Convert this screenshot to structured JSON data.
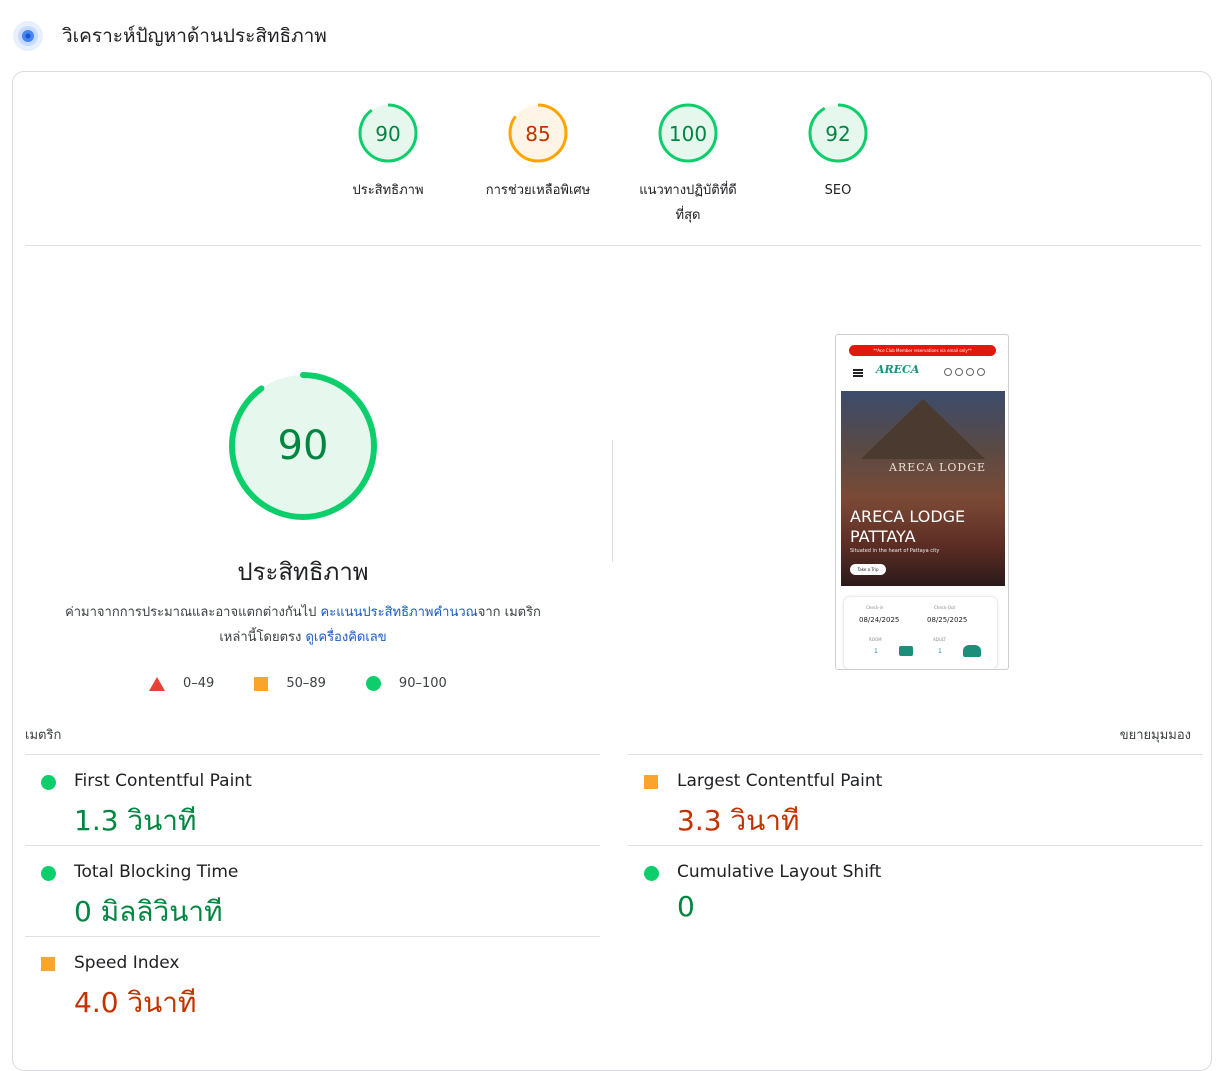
{
  "header": {
    "title": "วิเคราะห์ปัญหาด้านประสิทธิภาพ"
  },
  "colors": {
    "pass": "#0cce6b",
    "average": "#ffa400",
    "fail": "#ff4e42",
    "link": "#1a5bc4"
  },
  "categories": [
    {
      "label": "ประสิทธิภาพ",
      "score": "90",
      "score_value": 90,
      "rating": "pass"
    },
    {
      "label": "การช่วยเหลือพิเศษ",
      "score": "85",
      "score_value": 85,
      "rating": "average"
    },
    {
      "label": "แนวทางปฏิบัติที่ดีที่สุด",
      "score": "100",
      "score_value": 100,
      "rating": "pass"
    },
    {
      "label": "SEO",
      "score": "92",
      "score_value": 92,
      "rating": "pass"
    }
  ],
  "performance": {
    "score": "90",
    "score_value": 90,
    "title": "ประสิทธิภาพ",
    "desc_prefix": "ค่ามาจากการประมาณและอาจแตกต่างกันไป ",
    "desc_link1": "คะแนนประสิทธิภาพคำนวณ",
    "desc_middle": "จาก เมตริกเหล่านี้โดยตรง ",
    "desc_link2": "ดูเครื่องคิดเลข"
  },
  "legend": [
    {
      "range": "0–49",
      "icon": "fail-triangle-icon"
    },
    {
      "range": "50–89",
      "icon": "average-square-icon"
    },
    {
      "range": "90–100",
      "icon": "pass-circle-icon"
    }
  ],
  "screenshot": {
    "banner": "**Ace Club Member reservations via email only**",
    "logo": "ARECA",
    "sign": "ARECA LODGE",
    "hero_title_1": "ARECA LODGE",
    "hero_title_2": "PATTAYA",
    "hero_subtitle": "Situated in the heart of Pattaya city",
    "hero_button": "Take a Trip",
    "checkin_label": "Check-in",
    "checkout_label": "Check-Out",
    "checkin_date": "08/24/2025",
    "checkout_date": "08/25/2025",
    "room_label": "ROOM",
    "room_value": "1",
    "adult_label": "ADULT",
    "adult_value": "1"
  },
  "metrics_header": {
    "title": "เมตริก",
    "expand": "ขยายมุมมอง"
  },
  "metrics": {
    "fcp": {
      "name": "First Contentful Paint",
      "value": "1.3 วินาที",
      "rating": "pass"
    },
    "lcp": {
      "name": "Largest Contentful Paint",
      "value": "3.3 วินาที",
      "rating": "average"
    },
    "tbt": {
      "name": "Total Blocking Time",
      "value": "0 มิลลิวินาที",
      "rating": "pass"
    },
    "cls": {
      "name": "Cumulative Layout Shift",
      "value": "0",
      "rating": "pass"
    },
    "si": {
      "name": "Speed Index",
      "value": "4.0 วินาที",
      "rating": "average"
    }
  }
}
